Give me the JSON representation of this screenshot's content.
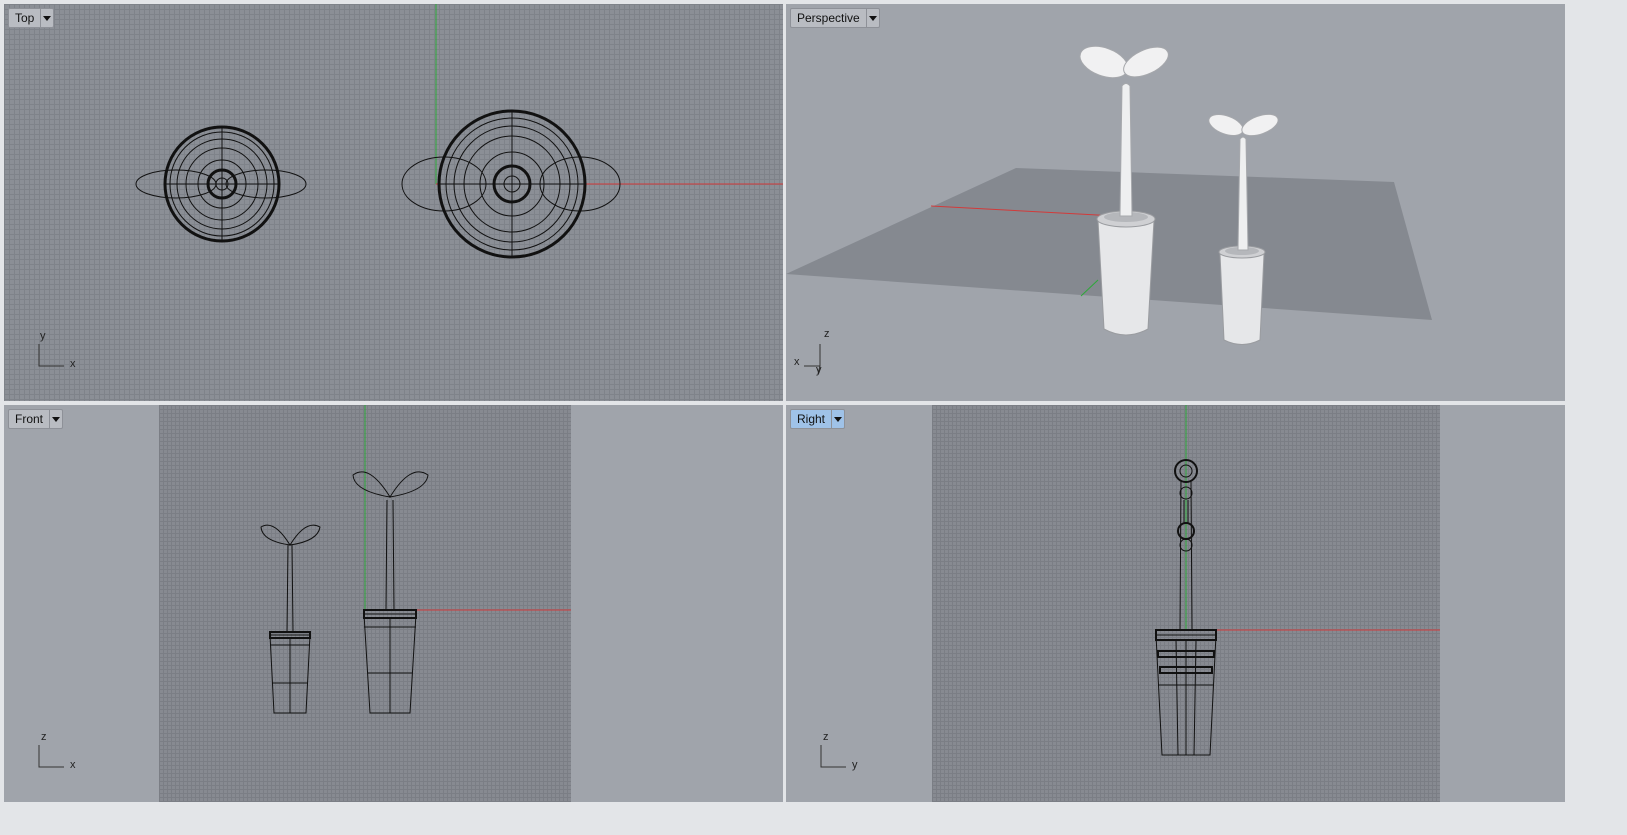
{
  "viewports": {
    "top": {
      "label": "Top",
      "axis_a": "y",
      "axis_b": "x"
    },
    "perspective": {
      "label": "Perspective",
      "axis_a": "z",
      "axis_b": "x",
      "axis_c": "y"
    },
    "front": {
      "label": "Front",
      "axis_a": "z",
      "axis_b": "x"
    },
    "right": {
      "label": "Right",
      "axis_a": "z",
      "axis_b": "y"
    }
  },
  "active_viewport": "Right",
  "colors": {
    "x_axis": "#d23a3a",
    "y_axis": "#2ea83a",
    "highlight": "#9fc2e8",
    "wire": "#111111"
  },
  "icons": {
    "dropdown": "chevron-down-icon",
    "axes": "axis-triad-icon"
  }
}
